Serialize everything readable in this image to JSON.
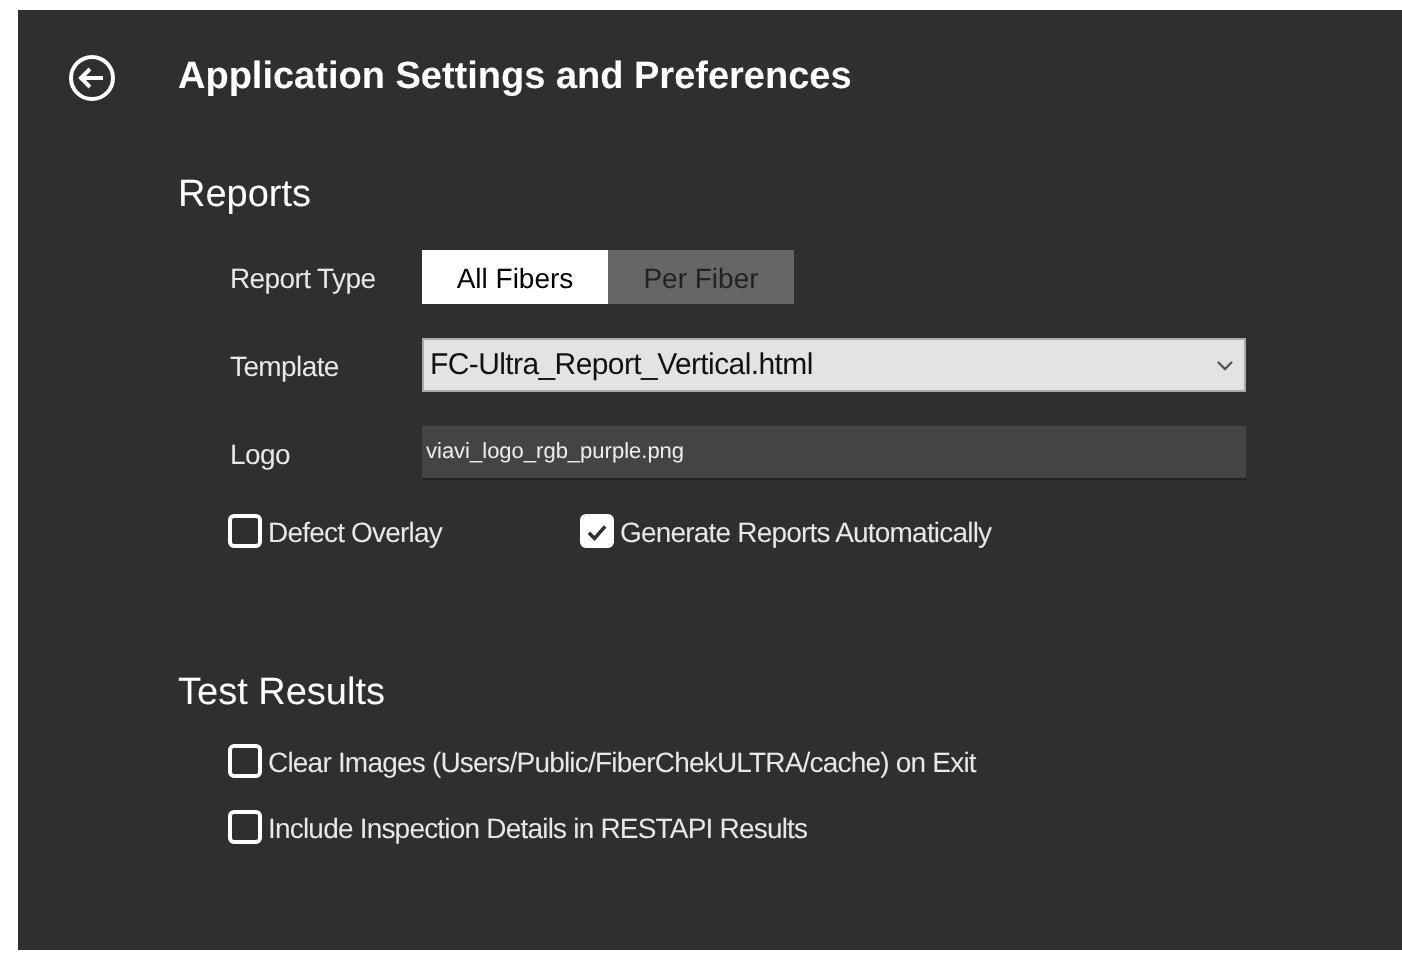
{
  "title": "Application Settings and Preferences",
  "reports": {
    "heading": "Reports",
    "report_type": {
      "label": "Report Type",
      "options": [
        {
          "label": "All Fibers",
          "selected": true
        },
        {
          "label": "Per Fiber",
          "selected": false
        }
      ]
    },
    "template": {
      "label": "Template",
      "value": "FC-Ultra_Report_Vertical.html"
    },
    "logo": {
      "label": "Logo",
      "value": "viavi_logo_rgb_purple.png"
    },
    "options": [
      {
        "label": "Defect Overlay",
        "checked": false
      },
      {
        "label": "Generate Reports Automatically",
        "checked": true
      }
    ]
  },
  "test_results": {
    "heading": "Test Results",
    "options": [
      {
        "label": "Clear Images (Users/Public/FiberChekULTRA/cache) on Exit",
        "checked": false
      },
      {
        "label": "Include Inspection Details in RESTAPI Results",
        "checked": false
      }
    ]
  }
}
